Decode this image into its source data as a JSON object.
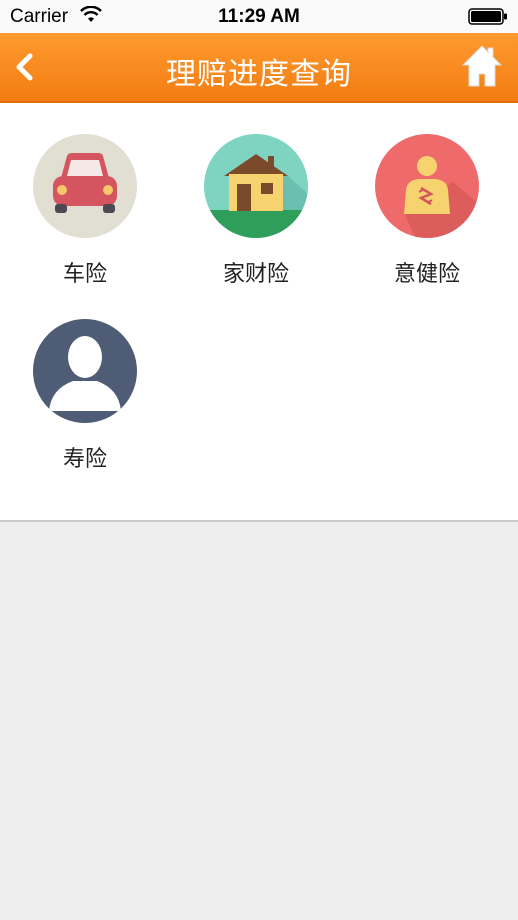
{
  "status_bar": {
    "carrier": "Carrier",
    "time": "11:29 AM"
  },
  "nav": {
    "title": "理赔进度查询",
    "back_icon": "chevron-left-icon",
    "home_icon": "home-icon"
  },
  "colors": {
    "nav_orange": "#f7871b",
    "car_bg": "#e0dfd2",
    "home_bg": "#7fd3c1",
    "health_bg": "#ef6b6b",
    "life_bg": "#4e5c75"
  },
  "items": [
    {
      "label": "车险",
      "icon": "car-icon"
    },
    {
      "label": "家财险",
      "icon": "house-icon"
    },
    {
      "label": "意健险",
      "icon": "injured-person-icon"
    },
    {
      "label": "寿险",
      "icon": "person-silhouette-icon"
    }
  ]
}
